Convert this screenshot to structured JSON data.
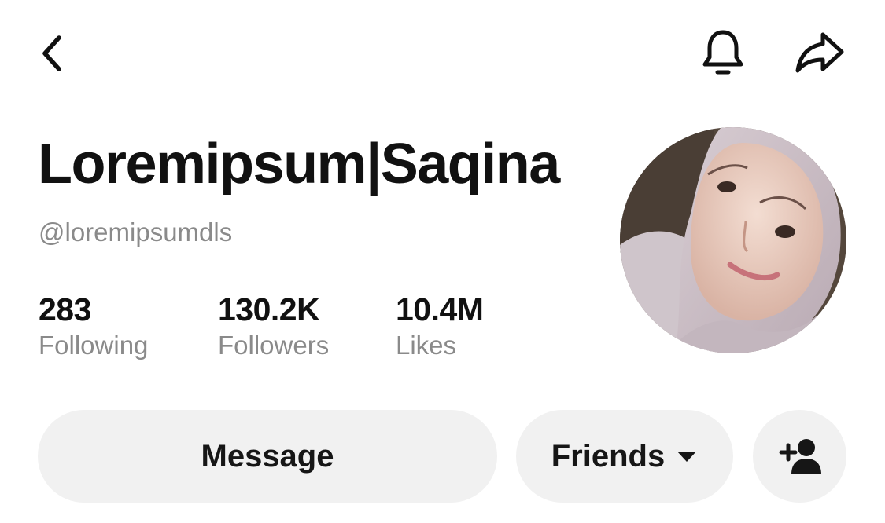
{
  "header": {
    "back_icon": "chevron-left-icon",
    "notification_icon": "bell-icon",
    "share_icon": "share-arrow-icon"
  },
  "profile": {
    "display_name": "Loremipsum|Saqina",
    "username": "@loremipsumdls",
    "avatar_icon": "profile-photo"
  },
  "stats": [
    {
      "value": "283",
      "label": "Following"
    },
    {
      "value": "130.2K",
      "label": "Followers"
    },
    {
      "value": "10.4M",
      "label": "Likes"
    }
  ],
  "actions": {
    "message_label": "Message",
    "friends_label": "Friends",
    "friends_icon": "caret-down-icon",
    "add_friend_icon": "add-user-icon"
  },
  "colors": {
    "text": "#111111",
    "secondary_text": "#8a8a8a",
    "button_background": "#f1f1f1",
    "background": "#ffffff"
  }
}
